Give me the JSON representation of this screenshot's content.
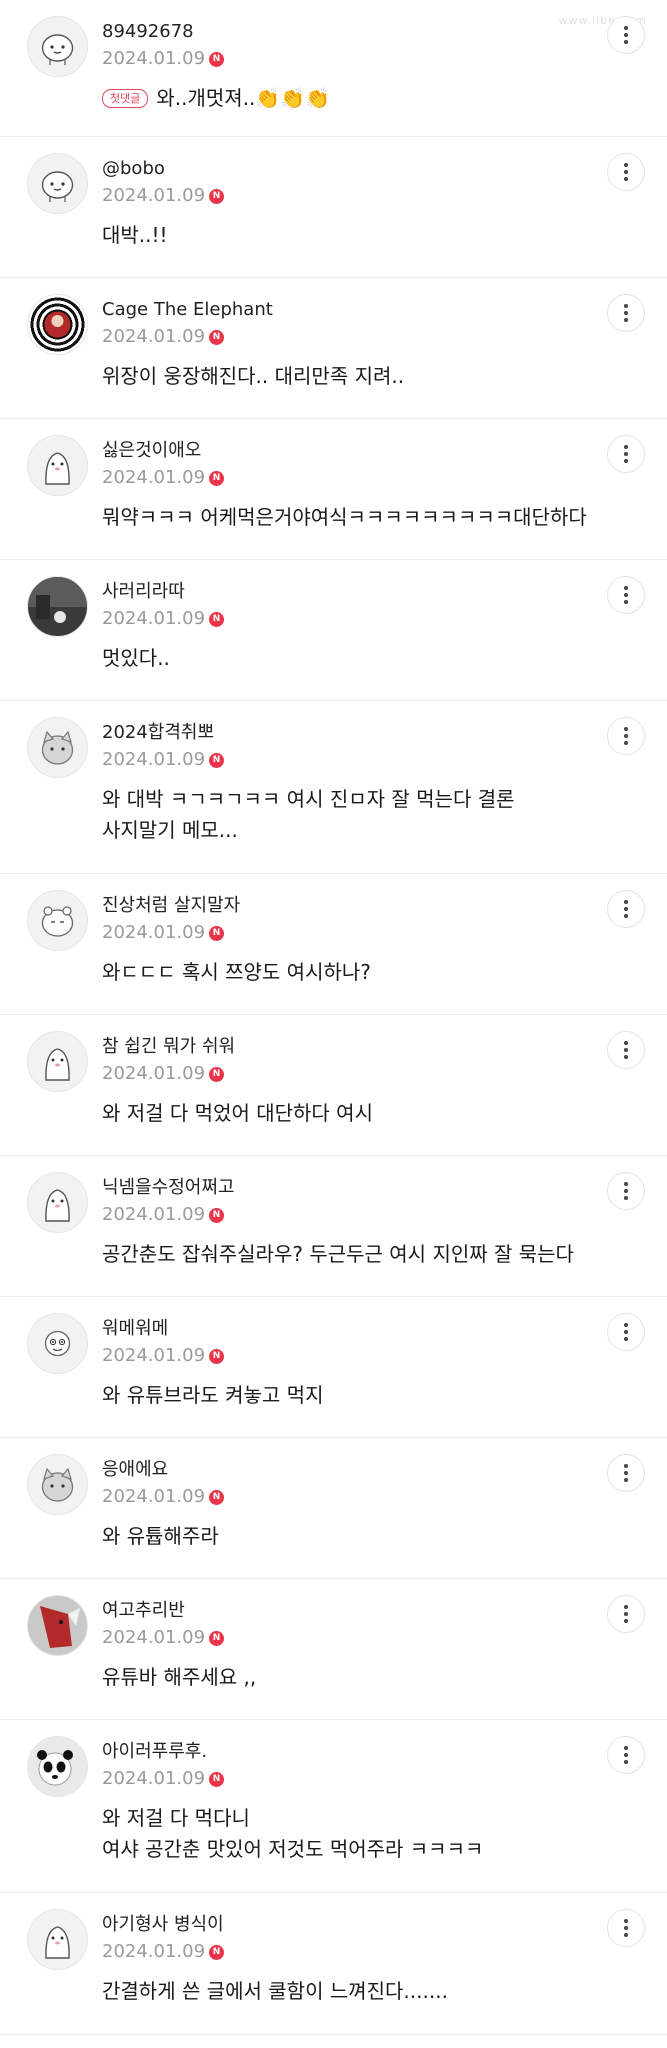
{
  "watermark": "www.ilbe.com",
  "first_badge_label": "첫댓글",
  "new_badge_label": "N",
  "comments": [
    {
      "nickname": "89492678",
      "date": "2024.01.09",
      "text": "와..개멋져..👏👏👏",
      "first": true
    },
    {
      "nickname": "@bobo",
      "date": "2024.01.09",
      "text": "대박..!!"
    },
    {
      "nickname": "Cage The Elephant",
      "date": "2024.01.09",
      "text": "위장이 웅장해진다.. 대리만족 지려.."
    },
    {
      "nickname": "싫은것이애오",
      "date": "2024.01.09",
      "text": "뭐약ㅋㅋㅋ 어케먹은거야여식ㅋㅋㅋㅋㅋㅋㅋㅋㅋ대단하다"
    },
    {
      "nickname": "사러리라따",
      "date": "2024.01.09",
      "text": "멋있다.."
    },
    {
      "nickname": "2024합격취뽀",
      "date": "2024.01.09",
      "text": "와 대박 ㅋㄱㅋㄱㅋㅋ 여시 진ㅁ자 잘 먹는다 결론\n사지말기 메모..."
    },
    {
      "nickname": "진상처럼 살지말자",
      "date": "2024.01.09",
      "text": "와ㄷㄷㄷ 혹시 쯔양도 여시하나?"
    },
    {
      "nickname": "참 쉽긴 뭐가 쉬워",
      "date": "2024.01.09",
      "text": "와 저걸 다 먹었어 대단하다 여시"
    },
    {
      "nickname": "닉넴을수정어쩌고",
      "date": "2024.01.09",
      "text": "공간춘도 잡숴주실라우? 두근두근 여시 지인짜 잘 묵는다"
    },
    {
      "nickname": "워메워메",
      "date": "2024.01.09",
      "text": "와 유튜브라도 켜놓고 먹지"
    },
    {
      "nickname": "응애에요",
      "date": "2024.01.09",
      "text": "와 유튭해주라"
    },
    {
      "nickname": "여고추리반",
      "date": "2024.01.09",
      "text": "유튜바 해주세요 ,,"
    },
    {
      "nickname": "아이러푸루후.",
      "date": "2024.01.09",
      "text": "와 저걸 다 먹다니\n여샤 공간춘 맛있어 저것도 먹어주라 ㅋㅋㅋㅋ"
    },
    {
      "nickname": "아기형사 병식이",
      "date": "2024.01.09",
      "text": "간결하게 쓴 글에서 쿨함이 느껴진다......."
    }
  ]
}
